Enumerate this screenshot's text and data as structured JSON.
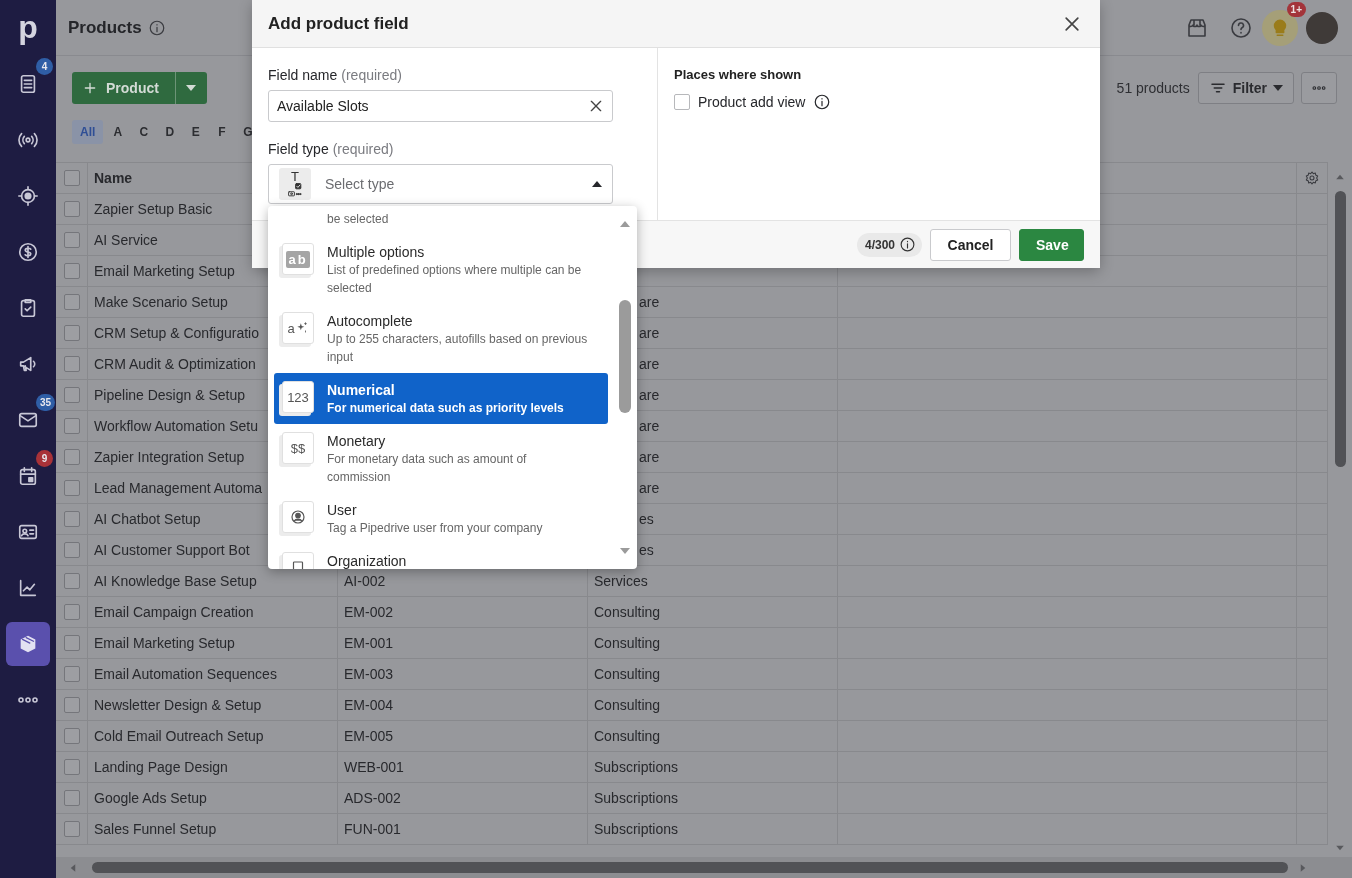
{
  "sidebar": {
    "logo": "p",
    "items": [
      {
        "badge": "4",
        "color": "#2f5ea6",
        "selected": false
      },
      {
        "selected": false
      },
      {
        "selected": false
      },
      {
        "selected": false
      },
      {
        "selected": false
      },
      {
        "selected": false
      },
      {
        "badge": "35",
        "color": "#2f5ea6",
        "selected": false
      },
      {
        "badge": "9",
        "color": "#a83238",
        "selected": false
      },
      {
        "selected": false
      },
      {
        "selected": false
      },
      {
        "selected": true
      },
      {
        "selected": false
      }
    ]
  },
  "header": {
    "title": "Products",
    "notifications_badge": "1+"
  },
  "toolbar": {
    "add_button": "Product",
    "count": "51 products",
    "filter_button": "Filter"
  },
  "alphabet": [
    {
      "label": "All",
      "selected": true
    },
    {
      "label": "A",
      "selected": false
    },
    {
      "label": "C",
      "selected": false
    },
    {
      "label": "D",
      "selected": false
    },
    {
      "label": "E",
      "selected": false
    },
    {
      "label": "F",
      "selected": false
    },
    {
      "label": "G",
      "selected": false
    }
  ],
  "table": {
    "columns": [
      "Name"
    ],
    "header_checked": false,
    "rows": [
      {
        "name": "Zapier Setup Basic",
        "checked": false
      },
      {
        "name": "AI Service",
        "checked": false
      },
      {
        "name": "Email Marketing Setup",
        "checked": false
      },
      {
        "name": "Make Scenario Setup",
        "column_3": "are",
        "checked": false
      },
      {
        "name": "CRM Setup & Configuratio",
        "column_3": "are",
        "checked": false
      },
      {
        "name": "CRM Audit & Optimization",
        "column_3": "are",
        "checked": false
      },
      {
        "name": "Pipeline Design & Setup",
        "column_3": "are",
        "checked": false
      },
      {
        "name": "Workflow Automation Setu",
        "column_3": "are",
        "checked": false
      },
      {
        "name": "Zapier Integration Setup",
        "column_3": "are",
        "checked": false
      },
      {
        "name": "Lead Management Automa",
        "column_3": "are",
        "checked": false
      },
      {
        "name": "AI Chatbot Setup",
        "column_3": "es",
        "checked": false
      },
      {
        "name": "AI Customer Support Bot",
        "column_3": "es",
        "checked": false
      },
      {
        "name": "AI Knowledge Base Setup",
        "column_2": "AI-002",
        "column_3": "Services",
        "checked": false
      },
      {
        "name": "Email Campaign Creation",
        "column_2": "EM-002",
        "column_3": "Consulting",
        "checked": false
      },
      {
        "name": "Email Marketing Setup",
        "column_2": "EM-001",
        "column_3": "Consulting",
        "checked": false
      },
      {
        "name": "Email Automation Sequences",
        "column_2": "EM-003",
        "column_3": "Consulting",
        "checked": false
      },
      {
        "name": "Newsletter Design & Setup",
        "column_2": "EM-004",
        "column_3": "Consulting",
        "checked": false
      },
      {
        "name": "Cold Email Outreach Setup",
        "column_2": "EM-005",
        "column_3": "Consulting",
        "checked": false
      },
      {
        "name": "Landing Page Design",
        "column_2": "WEB-001",
        "column_3": "Subscriptions",
        "checked": false
      },
      {
        "name": "Google Ads Setup",
        "column_2": "ADS-002",
        "column_3": "Subscriptions",
        "checked": false
      },
      {
        "name": "Sales Funnel Setup",
        "column_2": "FUN-001",
        "column_3": "Subscriptions",
        "checked": false
      }
    ]
  },
  "modal": {
    "title": "Add product field",
    "field_name": {
      "label": "Field name",
      "hint": "(required)",
      "value": "Available Slots"
    },
    "field_type": {
      "label": "Field type",
      "hint": "(required)",
      "icon_label": "T",
      "placeholder": "Select type",
      "expanded": true,
      "options": [
        {
          "kind": "tail",
          "description": "be selected",
          "selected": false
        },
        {
          "kind": "option",
          "icon_label": "ab",
          "title": "Multiple options",
          "description": "List of predefined options where multiple can be selected",
          "selected": false
        },
        {
          "kind": "option",
          "icon_label": "a",
          "title": "Autocomplete",
          "description": "Up to 255 characters, autofills based on previous input",
          "selected": false
        },
        {
          "kind": "option",
          "icon_label": "123",
          "title": "Numerical",
          "description": "For numerical data such as priority levels",
          "selected": true
        },
        {
          "kind": "option",
          "icon_label": "$$",
          "title": "Monetary",
          "description": "For monetary data such as amount of commission",
          "selected": false
        },
        {
          "kind": "option",
          "title": "User",
          "description": "Tag a Pipedrive user from your company",
          "selected": false
        },
        {
          "kind": "option",
          "title": "Organization",
          "selected": false
        }
      ]
    },
    "places": {
      "title": "Places where shown",
      "options": [
        {
          "label": "Product add view",
          "checked": false
        }
      ]
    },
    "counter": "4/300",
    "buttons": [
      {
        "label": "Cancel",
        "kind": "secondary"
      },
      {
        "label": "Save",
        "kind": "primary"
      }
    ]
  }
}
